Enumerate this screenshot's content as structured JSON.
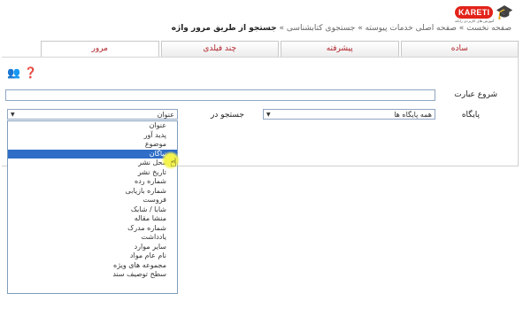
{
  "brand": {
    "badge": "KARETI",
    "tagline": "آموزش های کاربردی رایانه"
  },
  "breadcrumb": {
    "prefix": "صفحه نخست » صفحه اصلی خدمات پیوسته » جستجوی کتابشناسی »",
    "current": "جستجو از طریق مرور واژه"
  },
  "tabs": [
    {
      "label": "ساده"
    },
    {
      "label": "پیشرفته"
    },
    {
      "label": "چند فیلدی"
    },
    {
      "label": "مرور"
    }
  ],
  "form": {
    "phrase_label": "شروع عبارت",
    "database_label": "پایگاه",
    "database_value": "همه پایگاه ها",
    "search_in_label": "جستجو در",
    "search_in_value": "عنوان"
  },
  "dropdown_options": [
    "عنوان",
    "پدید آور",
    "موضوع",
    "نیاگان",
    "محل نشر",
    "تاریخ نشر",
    "شماره رده",
    "شماره بازیابی",
    "فروست",
    "شابا / شابک",
    "منشا مقاله",
    "شماره مدرک",
    "یادداشت",
    "سایر موارد",
    "نام عام مواد",
    "مجموعه های ویژه",
    "سطح توصیف سند"
  ]
}
